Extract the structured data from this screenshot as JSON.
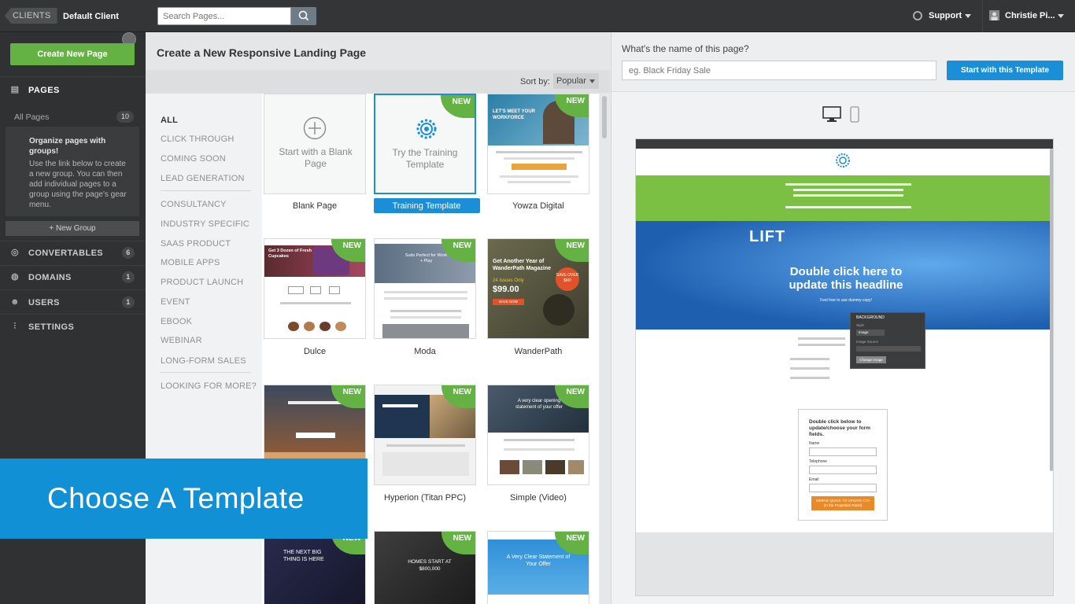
{
  "topbar": {
    "clients_label": "CLIENTS",
    "client_name": "Default Client",
    "search_placeholder": "Search Pages...",
    "support_label": "Support",
    "user_label": "Christie Pi..."
  },
  "sidebar": {
    "create_button": "Create New Page",
    "pages_label": "PAGES",
    "all_pages_label": "All Pages",
    "all_pages_count": "10",
    "groups_title": "Organize pages with groups!",
    "groups_text": "Use the link below to create a new group. You can then add individual pages to a group using the page's gear menu.",
    "new_group": "+ New Group",
    "items": [
      {
        "label": "CONVERTABLES",
        "count": "6"
      },
      {
        "label": "DOMAINS",
        "count": "1"
      },
      {
        "label": "USERS",
        "count": "1"
      },
      {
        "label": "SETTINGS",
        "count": ""
      }
    ]
  },
  "main": {
    "title": "Create a New Responsive Landing Page",
    "sort_label": "Sort by:",
    "sort_value": "Popular",
    "categories": [
      "ALL",
      "CLICK THROUGH",
      "COMING SOON",
      "LEAD GENERATION",
      "CONSULTANCY",
      "INDUSTRY SPECIFIC",
      "SAAS PRODUCT",
      "MOBILE APPS",
      "PRODUCT LAUNCH",
      "EVENT",
      "EBOOK",
      "WEBINAR",
      "LONG-FORM SALES",
      "LOOKING FOR MORE?"
    ],
    "blank_text": "Start with a Blank Page",
    "training_text": "Try the Training Template",
    "new_badge": "NEW",
    "templates": [
      {
        "name": "Blank Page"
      },
      {
        "name": "Training Template"
      },
      {
        "name": "Yowza Digital"
      },
      {
        "name": "Dulce"
      },
      {
        "name": "Moda"
      },
      {
        "name": "WanderPath"
      },
      {
        "name": ""
      },
      {
        "name": "Hyperion (Titan PPC)"
      },
      {
        "name": "Simple (Video)"
      }
    ],
    "thumb_text": {
      "dulce_title": "Get 3 Dozen of Fresh Cupcakes",
      "moda_title": "Suits Perfect for Work + Play",
      "wander_title": "Get Another Year of WanderPath Magazine",
      "wander_sub": "24 Issues Only",
      "wander_price": "$99.00",
      "wander_save": "SAVE OVER $60!",
      "wander_cta": "SAVE NOW",
      "yowza_title": "LET'S MEET YOUR WORKFORCE",
      "simple_title": "A very clear opening statement of your offer",
      "next_title": "THE NEXT BIG THING IS HERE",
      "homes_title": "HOMES START AT $800,000",
      "clear_title": "A Very Clear Statement of Your Offer"
    }
  },
  "right": {
    "question": "What's the name of this page?",
    "placeholder": "eg. Black Friday Sale",
    "start_button": "Start with this Template",
    "preview": {
      "headline": "Double click here to update this headline",
      "sub": "Feel free to use dummy copy!",
      "logo": "LIFT",
      "form_title": "Double click below to update/choose your form fields.",
      "field_name": "Name",
      "field_phone": "Telephone",
      "field_email": "Email",
      "cta": "SIMPLE QUICK TO UPDATE CTA",
      "cta_sub": "(In the Properties Panel)",
      "panel_title": "BACKGROUND",
      "panel_style": "Style",
      "panel_image": "Image",
      "panel_source": "Image Source",
      "panel_button": "Change Image"
    }
  },
  "overlay": {
    "text": "Choose A Template"
  }
}
